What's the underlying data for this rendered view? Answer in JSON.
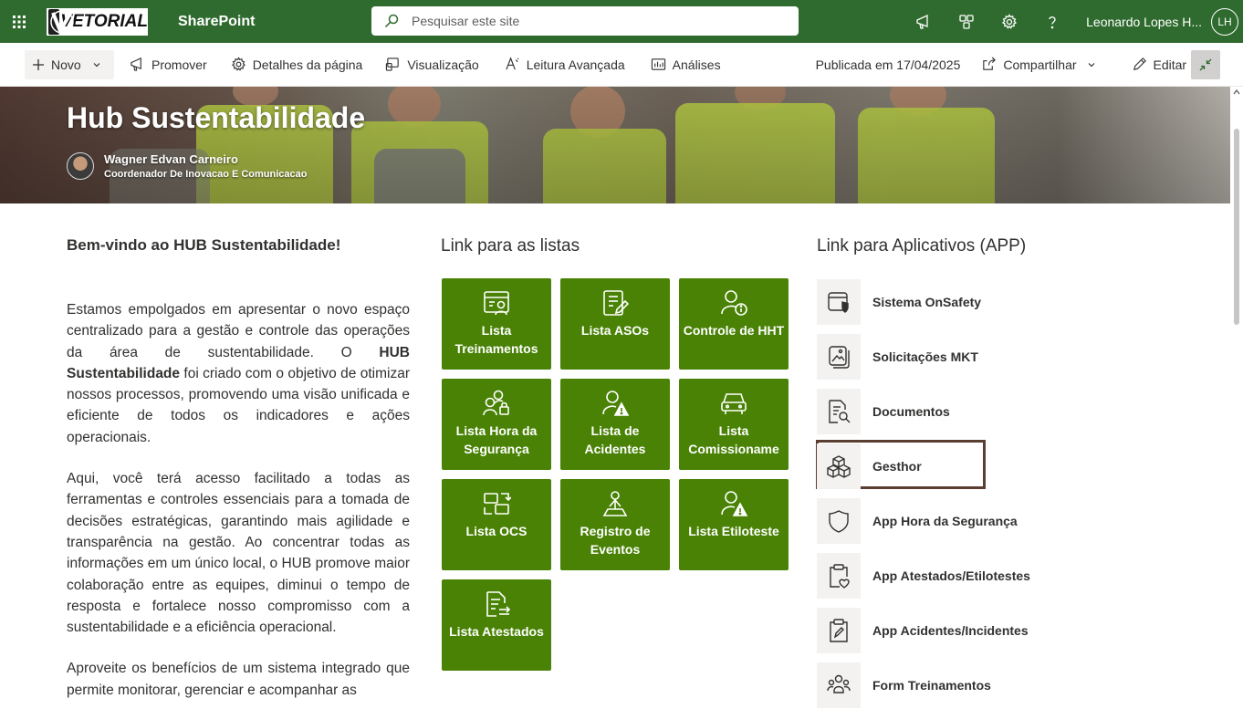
{
  "suite_bar": {
    "logo_text": "VETORIAL",
    "app_name": "SharePoint",
    "search_placeholder": "Pesquisar este site",
    "user_name": "Leonardo Lopes H...",
    "user_initials": "LH",
    "brand_color": "#2f6b2f"
  },
  "command_bar": {
    "new_label": "Novo",
    "promote_label": "Promover",
    "page_details_label": "Detalhes da página",
    "preview_label": "Visualização",
    "immersive_reader_label": "Leitura Avançada",
    "analytics_label": "Análises",
    "published_label": "Publicada em 17/04/2025",
    "share_label": "Compartilhar",
    "edit_label": "Editar"
  },
  "hero": {
    "title": "Hub Sustentabilidade",
    "author_name": "Wagner Edvan Carneiro",
    "author_role": "Coordenador De Inovacao E Comunicacao"
  },
  "welcome": {
    "title": "Bem-vindo ao HUB Sustentabilidade!",
    "p1_before": "Estamos empolgados em apresentar o novo espaço centralizado para a gestão e controle das operações da área de sustentabilidade. O ",
    "p1_bold": "HUB Sustentabilidade",
    "p1_after": " foi criado com o objetivo de otimizar nossos processos, promovendo uma visão unificada e eficiente de todos os indicadores e ações operacionais.",
    "p2": "Aqui, você terá acesso facilitado a todas as ferramentas e controles essenciais para a tomada de decisões estratégicas, garantindo mais agilidade e transparência na gestão. Ao concentrar todas as informações em um único local, o HUB promove maior colaboração entre as equipes, diminui o tempo de resposta e fortalece nosso compromisso com a sustentabilidade e a eficiência operacional.",
    "p3": "Aproveite os benefícios de um sistema integrado que permite monitorar, gerenciar e acompanhar as"
  },
  "lists": {
    "title": "Link para as listas",
    "tile_color": "#498205",
    "tiles": [
      {
        "label": "Lista Treinamentos",
        "icon": "treinamentos-icon"
      },
      {
        "label": "Lista ASOs",
        "icon": "document-edit-icon"
      },
      {
        "label": "Controle de HHT",
        "icon": "person-info-icon"
      },
      {
        "label": "Lista Hora da Segurança",
        "icon": "people-lock-icon"
      },
      {
        "label": "Lista de Acidentes",
        "icon": "person-warning-icon"
      },
      {
        "label": "Lista Comissioname",
        "icon": "vehicle-icon"
      },
      {
        "label": "Lista OCS",
        "icon": "arrow-swap-icon"
      },
      {
        "label": "Registro de Eventos",
        "icon": "location-person-icon"
      },
      {
        "label": "Lista Etiloteste",
        "icon": "person-warning-icon"
      },
      {
        "label": "Lista Atestados",
        "icon": "document-arrow-icon"
      }
    ]
  },
  "apps": {
    "title": "Link para Aplicativos (APP)",
    "items": [
      {
        "label": "Sistema OnSafety",
        "icon": "window-shield-icon"
      },
      {
        "label": "Solicitações MKT",
        "icon": "image-stack-icon"
      },
      {
        "label": "Documentos",
        "icon": "document-search-icon"
      },
      {
        "label": "Gesthor",
        "icon": "cubes-icon"
      },
      {
        "label": "App Hora da Segurança",
        "icon": "shield-icon"
      },
      {
        "label": "App Atestados/Etilotestes",
        "icon": "clipboard-heart-icon"
      },
      {
        "label": "App Acidentes/Incidentes",
        "icon": "clipboard-edit-icon"
      },
      {
        "label": "Form Treinamentos",
        "icon": "people-community-icon"
      }
    ],
    "highlight_color": "#5a3e32"
  }
}
